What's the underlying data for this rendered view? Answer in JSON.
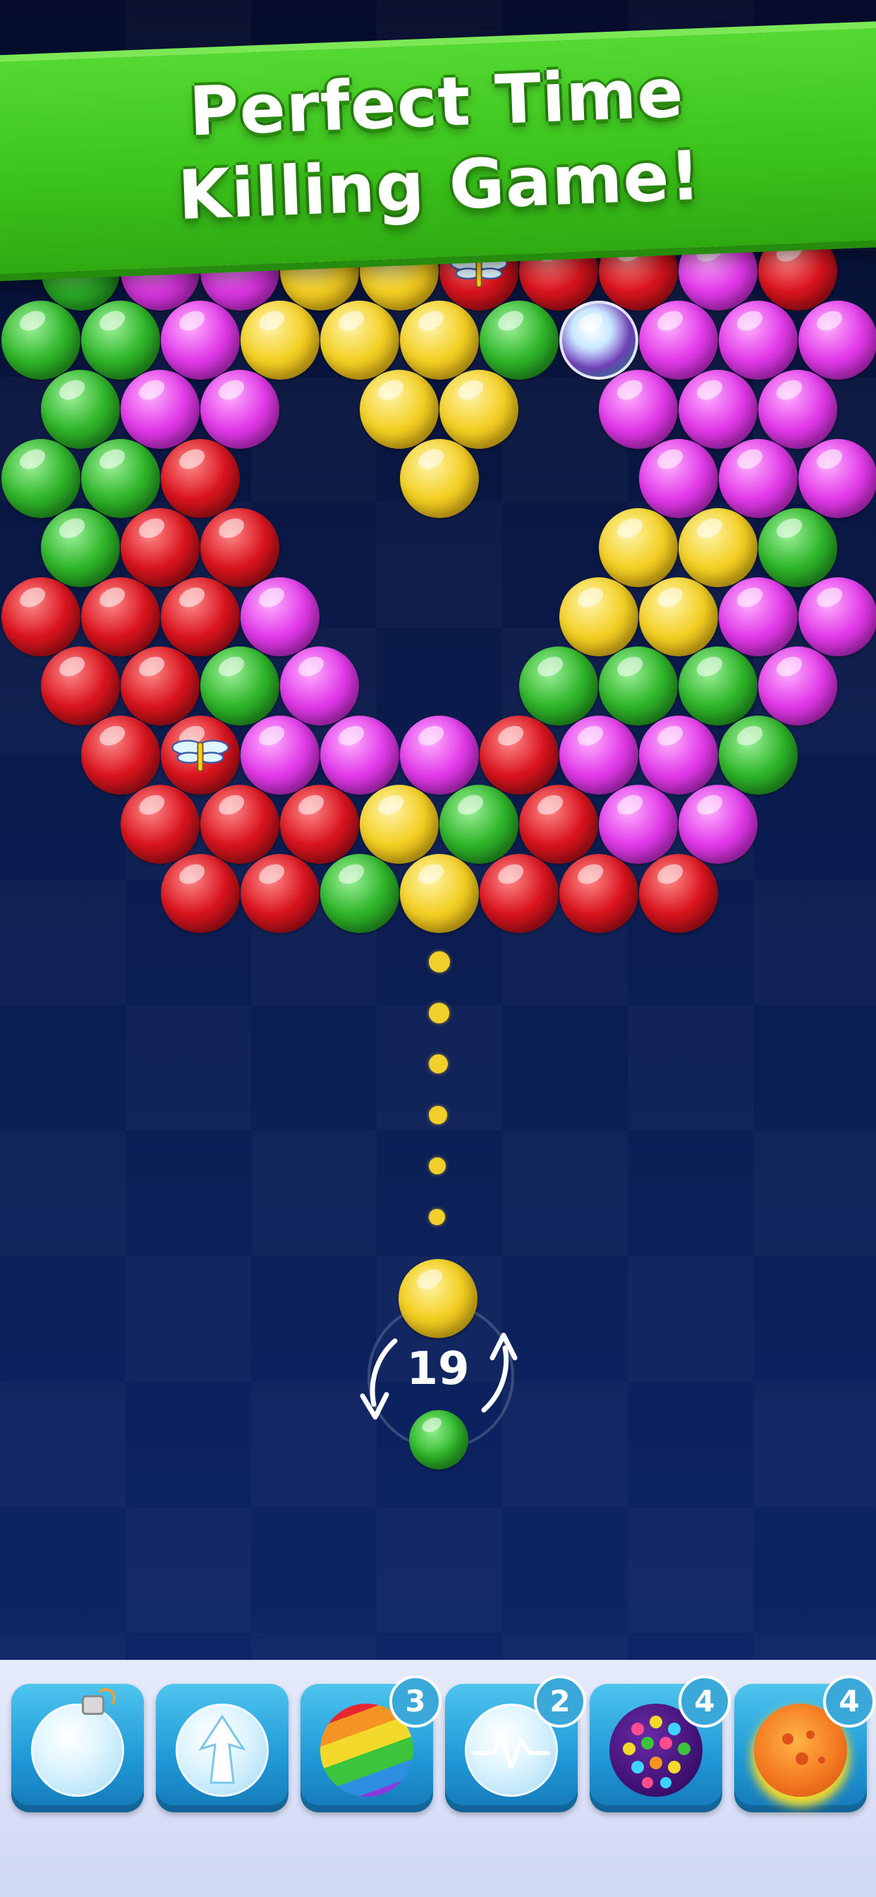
{
  "banner": {
    "line1": "Perfect Time",
    "line2": "Killing Game!"
  },
  "colors": {
    "green": "#2fb52a",
    "magenta": "#e13ae8",
    "yellow": "#f3cf23",
    "red": "#d9141e",
    "banner_green": "#3cc41c",
    "aim_dot": "#f2cf2a"
  },
  "grid": {
    "note": "",
    "rows": [
      [
        "G",
        "M",
        "M",
        "Y",
        "Y",
        "R",
        "R",
        "R",
        "M",
        "R"
      ],
      [
        "G",
        "G",
        "M",
        "Y",
        "Y",
        "Y",
        "G",
        "S",
        "M",
        "M",
        "M"
      ],
      [
        "G",
        "M",
        "M",
        "_",
        "Y",
        "Y",
        "_",
        "M",
        "M",
        "M"
      ],
      [
        "G",
        "G",
        "R",
        "_",
        "_",
        "Y",
        "_",
        "_",
        "M",
        "M",
        "M"
      ],
      [
        "G",
        "R",
        "R",
        "_",
        "_",
        "_",
        "_",
        "Y",
        "Y",
        "G"
      ],
      [
        "R",
        "R",
        "R",
        "M",
        "_",
        "_",
        "_",
        "Y",
        "Y",
        "M",
        "M"
      ],
      [
        "R",
        "R",
        "G",
        "M",
        "_",
        "_",
        "G",
        "G",
        "G",
        "M"
      ],
      [
        "_",
        "R",
        "R",
        "M",
        "M",
        "M",
        "R",
        "M",
        "M",
        "G",
        "_"
      ],
      [
        "_",
        "R",
        "R",
        "R",
        "Y",
        "G",
        "R",
        "M",
        "M",
        "_"
      ],
      [
        "_",
        "_",
        "R",
        "R",
        "G",
        "Y",
        "R",
        "R",
        "R",
        "_",
        "_"
      ]
    ],
    "specials": [
      {
        "type": "dragonfly",
        "row": 0,
        "col": 5
      },
      {
        "type": "dragonfly",
        "row": 7,
        "col": 2
      },
      {
        "type": "world-bubble",
        "row": 1,
        "col": 7
      }
    ]
  },
  "shooter": {
    "moves_left": "19",
    "current_bubble": "yellow",
    "next_bubble": "green",
    "aim_dot_count": 6
  },
  "boosters": [
    {
      "name": "bomb-bubble-icon",
      "count": ""
    },
    {
      "name": "arrow-bubble-icon",
      "count": ""
    },
    {
      "name": "rainbow-bubble-icon",
      "count": "3"
    },
    {
      "name": "lightning-bubble-icon",
      "count": "2"
    },
    {
      "name": "disco-ball-icon",
      "count": "4"
    },
    {
      "name": "fireball-icon",
      "count": "4"
    }
  ]
}
